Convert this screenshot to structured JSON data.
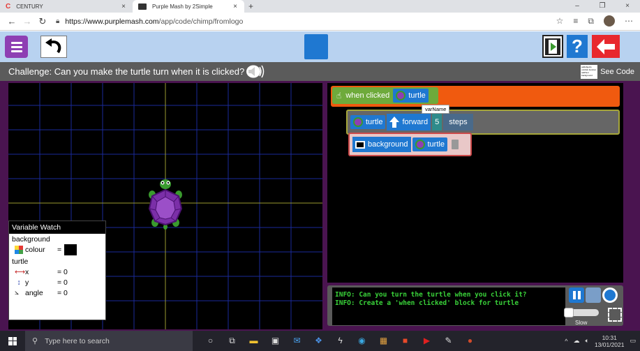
{
  "browser": {
    "tabs": [
      {
        "label": "CENTURY"
      },
      {
        "label": "Purple Mash by 2Simple"
      }
    ],
    "tab_close": "×",
    "new_tab": "+",
    "url_host": "https://www.purplemash.com",
    "url_path": "/app/code/chimp/fromlogo",
    "win_minimize": "–",
    "win_maximize": "❐",
    "win_close": "×"
  },
  "challenge": {
    "text": "Challenge: Can you make the turtle turn when it is clicked?",
    "see_code_label": "See Code",
    "see_code_thumb": "addobjects onClick function addText background"
  },
  "code": {
    "event_label": "when clicked",
    "event_object": "turtle",
    "tooltip": "varName",
    "forward_object": "turtle",
    "forward_label": "forward",
    "forward_value": "5",
    "steps_label": "steps",
    "background_label": "background",
    "background_object": "turtle"
  },
  "variable_watch": {
    "title": "Variable Watch",
    "groups": [
      {
        "name": "background",
        "vars": [
          {
            "label": "colour",
            "value": "="
          }
        ]
      },
      {
        "name": "turtle",
        "vars": [
          {
            "label": "x",
            "value": "= 0"
          },
          {
            "label": "y",
            "value": "= 0"
          },
          {
            "label": "angle",
            "value": "= 0"
          }
        ]
      }
    ]
  },
  "console": {
    "lines": [
      "INFO: Can you turn the turtle when you click it?",
      "INFO: Create a 'when clicked' block for turtle"
    ],
    "speed_label": "Slow"
  },
  "taskbar": {
    "search_placeholder": "Type here to search",
    "time": "10:31",
    "date": "13/01/2021"
  },
  "colors": {
    "app_purple": "#8e3fb3",
    "toolbar_blue": "#b8d2f0",
    "event_orange": "#f05a0f",
    "block_blue": "#1f78d1",
    "console_green": "#39d139"
  }
}
